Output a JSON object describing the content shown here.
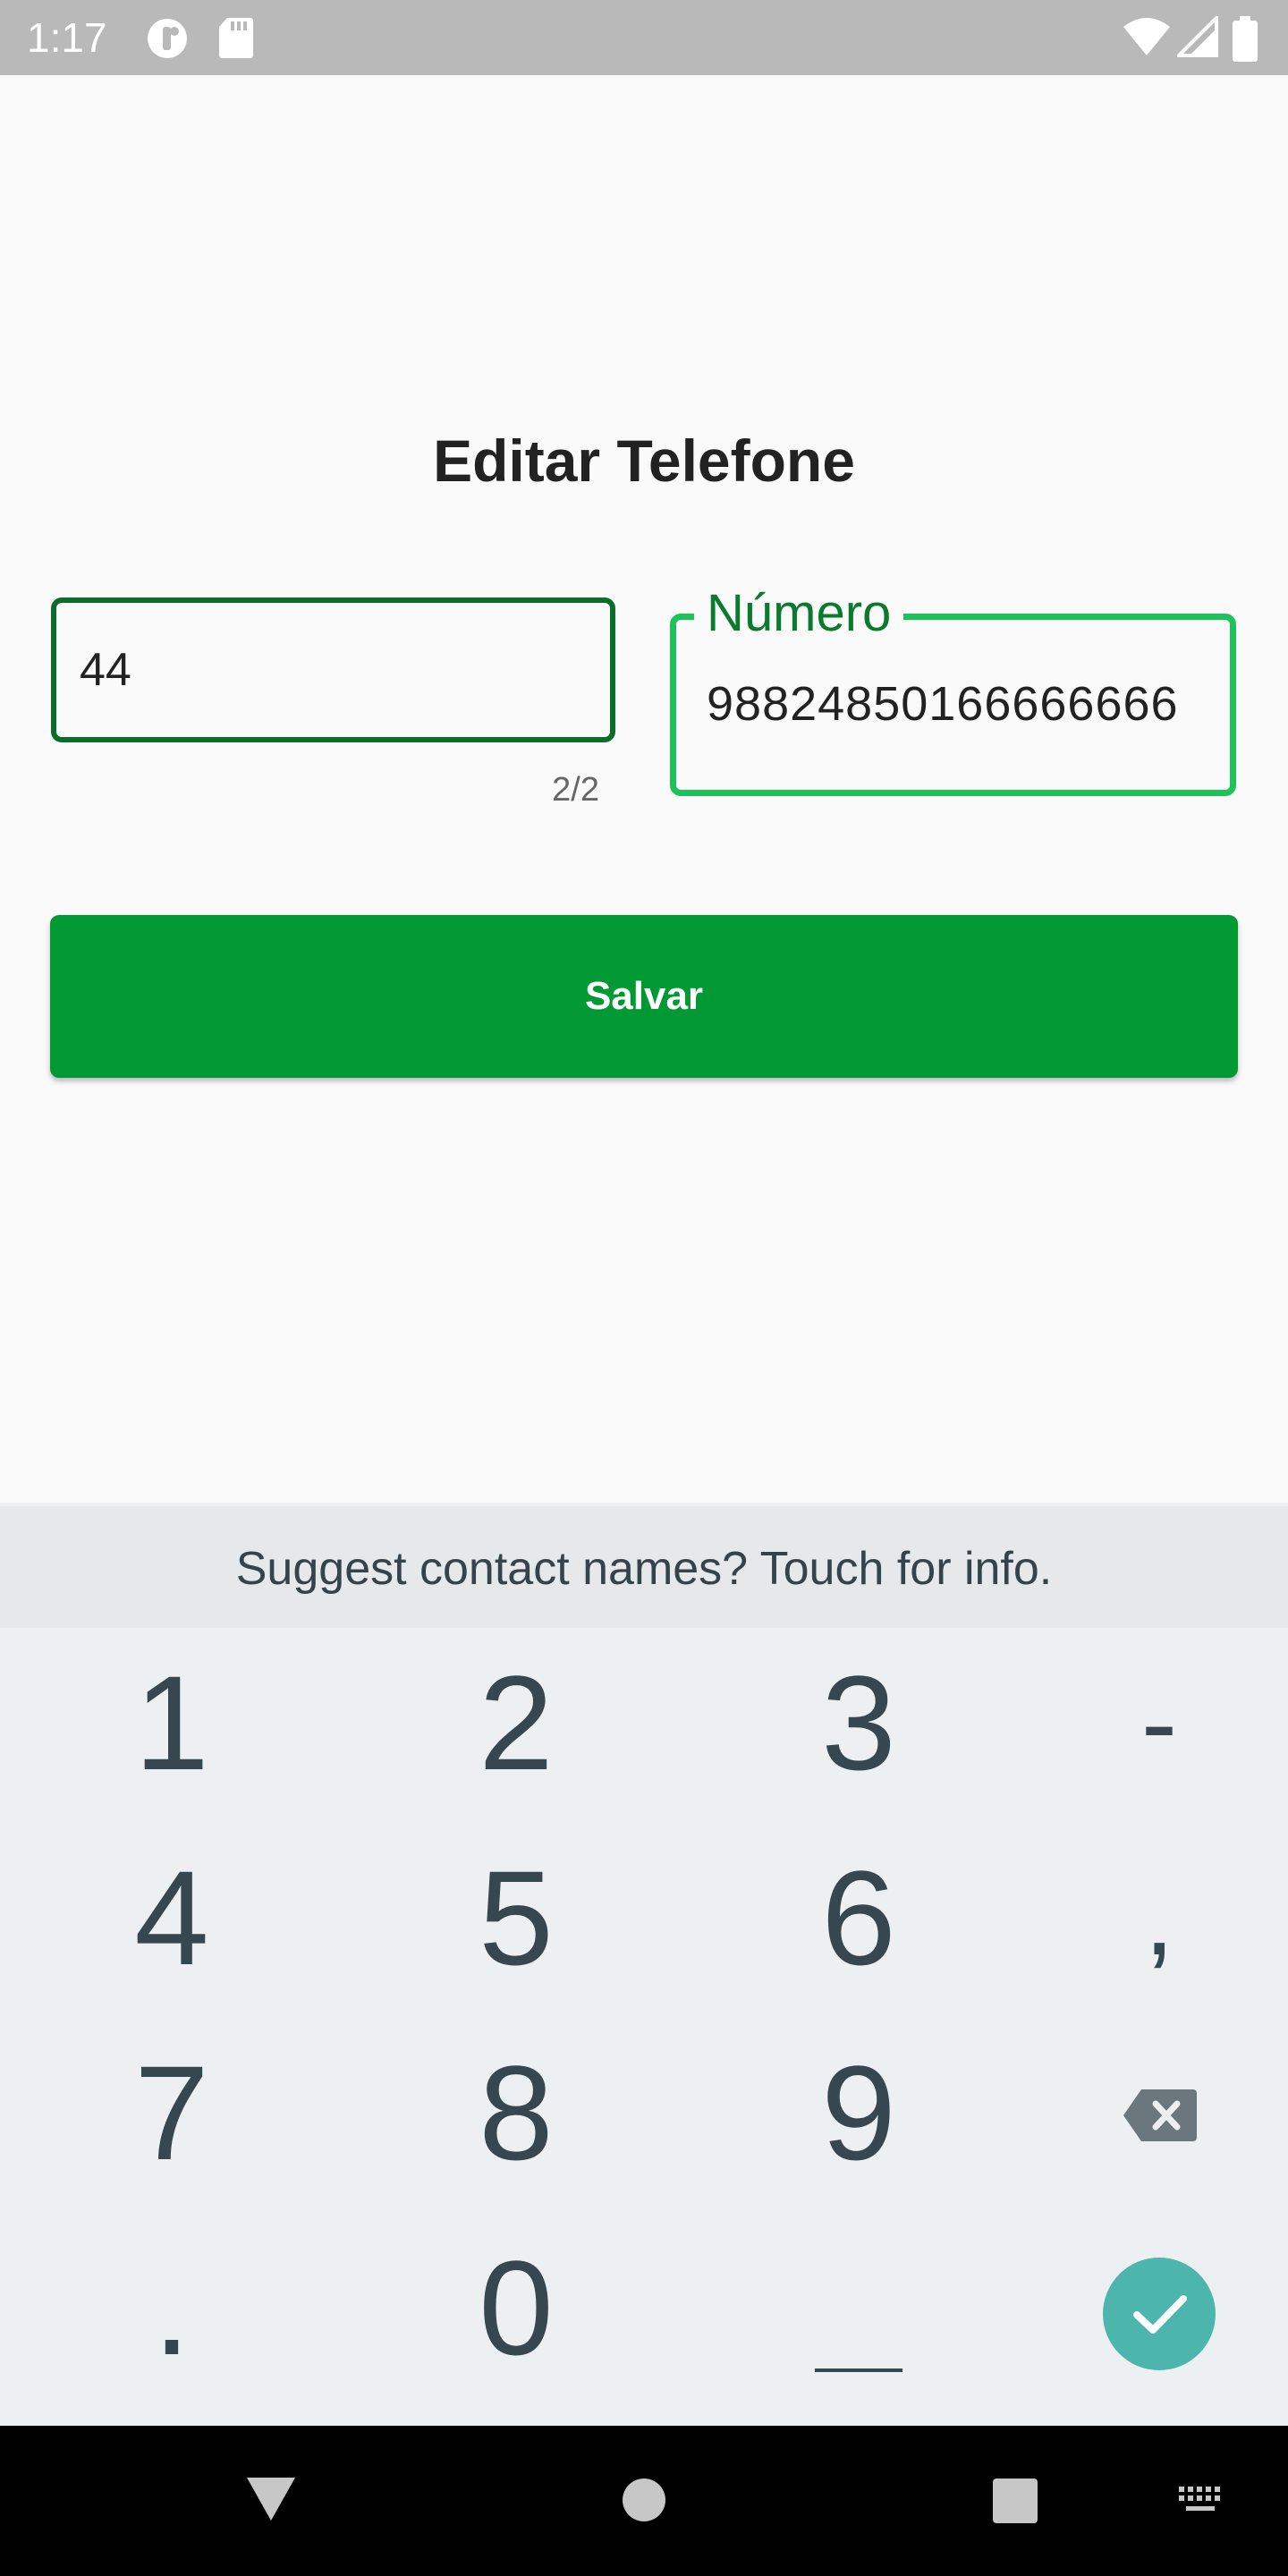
{
  "status_bar": {
    "time": "1:17",
    "icons": [
      "notification-app-icon",
      "sd-card-icon",
      "wifi-icon",
      "signal-icon",
      "battery-icon"
    ]
  },
  "page": {
    "title": "Editar Telefone"
  },
  "form": {
    "area_code": {
      "value": "44",
      "counter": "2/2"
    },
    "number": {
      "label": "Número",
      "value": "98824850166666666"
    },
    "save_label": "Salvar"
  },
  "keyboard": {
    "suggestion": "Suggest contact names? Touch for info.",
    "keys": {
      "k1": "1",
      "k2": "2",
      "k3": "3",
      "dash": "-",
      "k4": "4",
      "k5": "5",
      "k6": "6",
      "comma": ",",
      "k7": "7",
      "k8": "8",
      "k9": "9",
      "dot": ".",
      "k0": "0"
    }
  },
  "nav_bar": {
    "icons": [
      "back-icon",
      "home-icon",
      "recents-icon",
      "keyboard-switch-icon"
    ]
  },
  "colors": {
    "accent": "#009933",
    "focused_border": "#1ec25a",
    "label_green": "#0a7a2e",
    "enter_key": "#4db6ac"
  }
}
